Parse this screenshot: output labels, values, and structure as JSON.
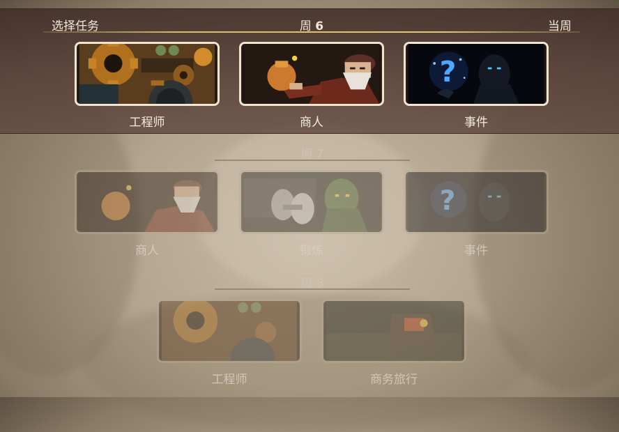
{
  "header": {
    "left_label": "选择任务",
    "week_prefix": "周",
    "week_number": "6",
    "right_label": "当周"
  },
  "current_week": {
    "cards": [
      {
        "label": "工程师",
        "icon": "gears-icon"
      },
      {
        "label": "商人",
        "icon": "merchant-icon"
      },
      {
        "label": "事件",
        "icon": "mystery-event-icon"
      }
    ]
  },
  "week7": {
    "title": "周 7",
    "cards": [
      {
        "label": "商人",
        "icon": "merchant-icon"
      },
      {
        "label": "锻炼",
        "icon": "training-icon"
      },
      {
        "label": "事件",
        "icon": "mystery-event-icon"
      }
    ]
  },
  "week8": {
    "title": "周 8",
    "cards": [
      {
        "label": "工程师",
        "icon": "gears-icon"
      },
      {
        "label": "商务旅行",
        "icon": "business-trip-icon"
      }
    ]
  },
  "colors": {
    "band": "#4a3530",
    "accent_line": "#d7bd6c",
    "card_border": "#efe6cf",
    "event_glow": "#4fa8ff"
  }
}
